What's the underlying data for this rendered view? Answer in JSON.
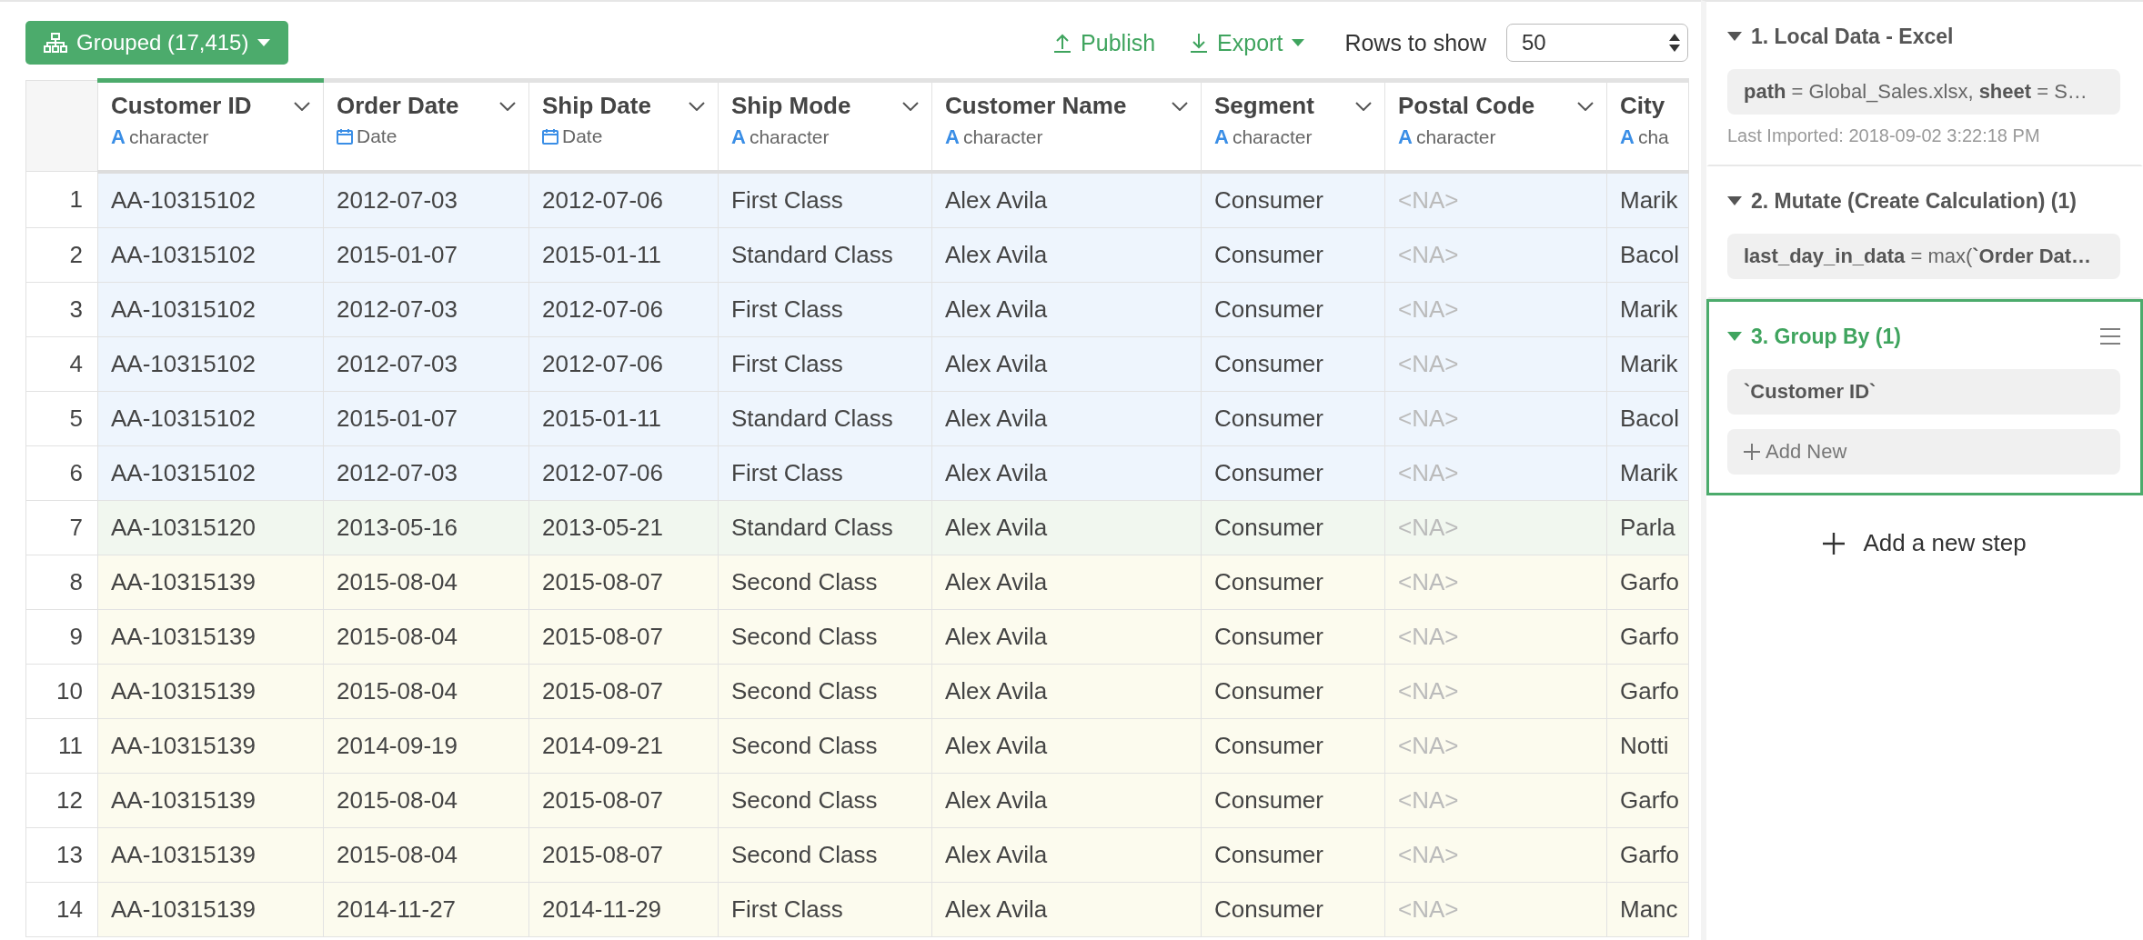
{
  "toolbar": {
    "group_button": {
      "label": "Grouped (17,415)"
    },
    "publish": {
      "label": "Publish"
    },
    "export": {
      "label": "Export"
    },
    "rows_to_show": {
      "label": "Rows to show",
      "value": "50"
    }
  },
  "table": {
    "columns": [
      {
        "name": "Customer ID",
        "type": "character",
        "kind": "text",
        "type_icon": "A",
        "selected": true,
        "muted": false
      },
      {
        "name": "Order Date",
        "type": "Date",
        "kind": "date",
        "selected": false,
        "muted": false
      },
      {
        "name": "Ship Date",
        "type": "Date",
        "kind": "date",
        "selected": false,
        "muted": false
      },
      {
        "name": "Ship Mode",
        "type": "character",
        "kind": "text",
        "type_icon": "A",
        "selected": false,
        "muted": false
      },
      {
        "name": "Customer Name",
        "type": "character",
        "kind": "text",
        "type_icon": "A",
        "selected": false,
        "muted": false
      },
      {
        "name": "Segment",
        "type": "character",
        "kind": "text",
        "type_icon": "A",
        "selected": false,
        "muted": false
      },
      {
        "name": "Postal Code",
        "type": "character",
        "kind": "text",
        "type_icon": "A",
        "selected": false,
        "muted": true
      },
      {
        "name": "City",
        "type": "cha",
        "kind": "text",
        "type_icon": "A",
        "selected": false,
        "muted": false
      }
    ],
    "rows": [
      {
        "number": "1",
        "color": "#eef5fd",
        "cells": [
          "AA-10315102",
          "2012-07-03",
          "2012-07-06",
          "First Class",
          "Alex Avila",
          "Consumer",
          "<NA>",
          "Marik"
        ]
      },
      {
        "number": "2",
        "color": "#eef5fd",
        "cells": [
          "AA-10315102",
          "2015-01-07",
          "2015-01-11",
          "Standard Class",
          "Alex Avila",
          "Consumer",
          "<NA>",
          "Bacol"
        ]
      },
      {
        "number": "3",
        "color": "#eef5fd",
        "cells": [
          "AA-10315102",
          "2012-07-03",
          "2012-07-06",
          "First Class",
          "Alex Avila",
          "Consumer",
          "<NA>",
          "Marik"
        ]
      },
      {
        "number": "4",
        "color": "#eef5fd",
        "cells": [
          "AA-10315102",
          "2012-07-03",
          "2012-07-06",
          "First Class",
          "Alex Avila",
          "Consumer",
          "<NA>",
          "Marik"
        ]
      },
      {
        "number": "5",
        "color": "#eef5fd",
        "cells": [
          "AA-10315102",
          "2015-01-07",
          "2015-01-11",
          "Standard Class",
          "Alex Avila",
          "Consumer",
          "<NA>",
          "Bacol"
        ]
      },
      {
        "number": "6",
        "color": "#eef5fd",
        "cells": [
          "AA-10315102",
          "2012-07-03",
          "2012-07-06",
          "First Class",
          "Alex Avila",
          "Consumer",
          "<NA>",
          "Marik"
        ]
      },
      {
        "number": "7",
        "color": "#f1f7ef",
        "cells": [
          "AA-10315120",
          "2013-05-16",
          "2013-05-21",
          "Standard Class",
          "Alex Avila",
          "Consumer",
          "<NA>",
          "Parla"
        ]
      },
      {
        "number": "8",
        "color": "#fcfbee",
        "cells": [
          "AA-10315139",
          "2015-08-04",
          "2015-08-07",
          "Second Class",
          "Alex Avila",
          "Consumer",
          "<NA>",
          "Garfo"
        ]
      },
      {
        "number": "9",
        "color": "#fcfbee",
        "cells": [
          "AA-10315139",
          "2015-08-04",
          "2015-08-07",
          "Second Class",
          "Alex Avila",
          "Consumer",
          "<NA>",
          "Garfo"
        ]
      },
      {
        "number": "10",
        "color": "#fcfbee",
        "cells": [
          "AA-10315139",
          "2015-08-04",
          "2015-08-07",
          "Second Class",
          "Alex Avila",
          "Consumer",
          "<NA>",
          "Garfo"
        ]
      },
      {
        "number": "11",
        "color": "#fcfbee",
        "cells": [
          "AA-10315139",
          "2014-09-19",
          "2014-09-21",
          "Second Class",
          "Alex Avila",
          "Consumer",
          "<NA>",
          "Notti"
        ]
      },
      {
        "number": "12",
        "color": "#fcfbee",
        "cells": [
          "AA-10315139",
          "2015-08-04",
          "2015-08-07",
          "Second Class",
          "Alex Avila",
          "Consumer",
          "<NA>",
          "Garfo"
        ]
      },
      {
        "number": "13",
        "color": "#fcfbee",
        "cells": [
          "AA-10315139",
          "2015-08-04",
          "2015-08-07",
          "Second Class",
          "Alex Avila",
          "Consumer",
          "<NA>",
          "Garfo"
        ]
      },
      {
        "number": "14",
        "color": "#fcfbee",
        "cells": [
          "AA-10315139",
          "2014-11-27",
          "2014-11-29",
          "First Class",
          "Alex Avila",
          "Consumer",
          "<NA>",
          "Manc"
        ]
      }
    ]
  },
  "steps": [
    {
      "title": "1. Local Data - Excel",
      "expanded": true,
      "selected": false,
      "params": [
        "**path** = Global_Sales.xlsx, **sheet** = S…"
      ],
      "note": "Last Imported: 2018-09-02 3:22:18 PM"
    },
    {
      "title": "2. Mutate (Create Calculation) (1)",
      "expanded": true,
      "selected": false,
      "params": [
        "**last_day_in_data** = max(**`Order Dat…**"
      ]
    },
    {
      "title": "3. Group By (1)",
      "expanded": true,
      "selected": true,
      "items": [
        "`Customer ID`"
      ],
      "add_new": "Add New"
    }
  ],
  "add_step": {
    "label": "Add a new step"
  }
}
